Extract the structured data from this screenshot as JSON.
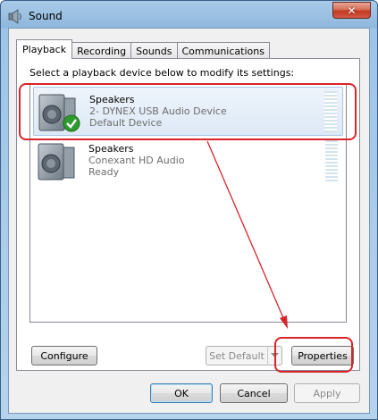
{
  "window": {
    "title": "Sound",
    "close_symbol": "✕",
    "icons": {
      "title": "speaker-icon",
      "close": "close-icon"
    }
  },
  "tabs": [
    {
      "label": "Playback",
      "active": true
    },
    {
      "label": "Recording",
      "active": false
    },
    {
      "label": "Sounds",
      "active": false
    },
    {
      "label": "Communications",
      "active": false
    }
  ],
  "playback": {
    "instruction": "Select a playback device below to modify its settings:",
    "devices": [
      {
        "name": "Speakers",
        "description": "2- DYNEX USB Audio Device",
        "status": "Default Device",
        "selected": true,
        "icon": "speaker-device-icon",
        "badge": "default-check-icon"
      },
      {
        "name": "Speakers",
        "description": "Conexant HD Audio",
        "status": "Ready",
        "selected": false,
        "icon": "speaker-device-icon"
      }
    ],
    "buttons": {
      "configure": "Configure",
      "set_default": "Set Default",
      "properties": "Properties"
    }
  },
  "dialog_buttons": {
    "ok": "OK",
    "cancel": "Cancel",
    "apply": "Apply"
  },
  "colors": {
    "annotation": "#d8242b",
    "default_check": "#2e9b2e"
  }
}
